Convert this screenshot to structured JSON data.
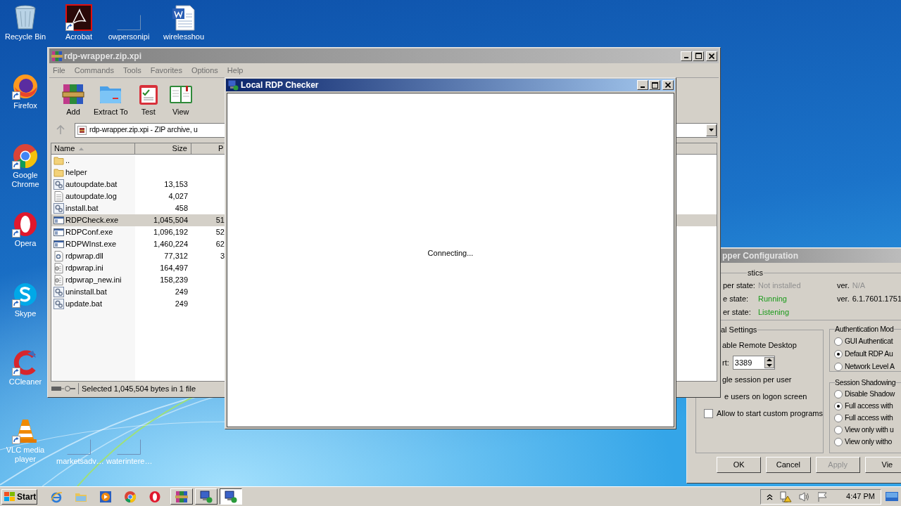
{
  "desktop_icons": [
    {
      "kind": "recycle-bin",
      "label": "Recycle Bin",
      "shortcut": false
    },
    {
      "kind": "acrobat",
      "label": "Acrobat",
      "shortcut": true
    },
    {
      "kind": "blank",
      "label": "owpersonipi",
      "shortcut": false
    },
    {
      "kind": "word",
      "label": "wirelesshou",
      "shortcut": false
    },
    {
      "kind": "firefox",
      "label": "Firefox",
      "shortcut": true
    },
    {
      "kind": "chrome",
      "label": "Google Chrome",
      "shortcut": true
    },
    {
      "kind": "opera",
      "label": "Opera",
      "shortcut": true
    },
    {
      "kind": "skype",
      "label": "Skype",
      "shortcut": true
    },
    {
      "kind": "ccleaner",
      "label": "CCleaner",
      "shortcut": true
    },
    {
      "kind": "vlc",
      "label": "VLC media player",
      "shortcut": true
    },
    {
      "kind": "blank",
      "label": "marketsadv…",
      "shortcut": false
    },
    {
      "kind": "blank",
      "label": "waterintere…",
      "shortcut": false
    }
  ],
  "config_window": {
    "title": "pper Configuration",
    "diagnostics": {
      "legend": "stics",
      "rows": [
        {
          "label": "per state:",
          "value": "Not installed",
          "kind": "na",
          "version_label": "ver.",
          "version": "N/A"
        },
        {
          "label": "e state:",
          "value": "Running",
          "kind": "ok",
          "version_label": "ver.",
          "version": "6.1.7601.1751"
        },
        {
          "label": "er state:",
          "value": "Listening",
          "kind": "ok"
        }
      ]
    },
    "general": {
      "legend": "al Settings",
      "items": [
        {
          "kind": "text",
          "label": "able Remote Desktop"
        },
        {
          "kind": "port",
          "label": "rt:",
          "value": "3389"
        },
        {
          "kind": "text",
          "label": "gle session per user"
        },
        {
          "kind": "text",
          "label": "e users on logon screen"
        },
        {
          "kind": "checkbox",
          "label": "Allow to start custom programs",
          "checked": false
        }
      ]
    },
    "authentication": {
      "legend": "Authentication Mod",
      "options": [
        {
          "label": "GUI Authenticat",
          "selected": false
        },
        {
          "label": "Default RDP Au",
          "selected": true
        },
        {
          "label": "Network Level A",
          "selected": false
        }
      ]
    },
    "shadowing": {
      "legend": "Session Shadowing",
      "options": [
        {
          "label": "Disable Shadow",
          "selected": false
        },
        {
          "label": "Full access with",
          "selected": true
        },
        {
          "label": "Full access with",
          "selected": false
        },
        {
          "label": "View only with u",
          "selected": false
        },
        {
          "label": "View only witho",
          "selected": false
        }
      ]
    },
    "buttons": [
      {
        "label": "OK",
        "disabled": false
      },
      {
        "label": "Cancel",
        "disabled": false
      },
      {
        "label": "Apply",
        "disabled": true
      },
      {
        "label": "Vie",
        "disabled": false
      }
    ]
  },
  "archive_window": {
    "title": "rdp-wrapper.zip.xpi",
    "menu": [
      "File",
      "Commands",
      "Tools",
      "Favorites",
      "Options",
      "Help"
    ],
    "toolbar": [
      {
        "kind": "add",
        "label": "Add"
      },
      {
        "kind": "extract",
        "label": "Extract To"
      },
      {
        "kind": "test",
        "label": "Test"
      },
      {
        "kind": "view",
        "label": "View"
      }
    ],
    "path": "rdp-wrapper.zip.xpi - ZIP archive, u",
    "columns": [
      "Name",
      "Size",
      "P"
    ],
    "rows": [
      {
        "kind": "folder",
        "name": "..",
        "selected": false
      },
      {
        "kind": "folder",
        "name": "helper",
        "selected": false
      },
      {
        "kind": "script",
        "name": "autoupdate.bat",
        "size": "13,153",
        "selected": false
      },
      {
        "kind": "text",
        "name": "autoupdate.log",
        "size": "4,027",
        "selected": false
      },
      {
        "kind": "script",
        "name": "install.bat",
        "size": "458",
        "selected": false
      },
      {
        "kind": "exe",
        "name": "RDPCheck.exe",
        "size": "1,045,504",
        "packed": "51",
        "selected": true
      },
      {
        "kind": "exe",
        "name": "RDPConf.exe",
        "size": "1,096,192",
        "packed": "52",
        "selected": false
      },
      {
        "kind": "exe",
        "name": "RDPWInst.exe",
        "size": "1,460,224",
        "packed": "62",
        "selected": false
      },
      {
        "kind": "dll",
        "name": "rdpwrap.dll",
        "size": "77,312",
        "packed": "3",
        "selected": false
      },
      {
        "kind": "ini",
        "name": "rdpwrap.ini",
        "size": "164,497",
        "selected": false
      },
      {
        "kind": "ini",
        "name": "rdpwrap_new.ini",
        "size": "158,239",
        "selected": false
      },
      {
        "kind": "script",
        "name": "uninstall.bat",
        "size": "249",
        "selected": false
      },
      {
        "kind": "script",
        "name": "update.bat",
        "size": "249",
        "selected": false
      }
    ],
    "status": "Selected 1,045,504 bytes in 1 file"
  },
  "checker_window": {
    "title": "Local RDP Checker",
    "message": "Connecting..."
  },
  "taskbar": {
    "start": "Start",
    "quick_launch": [
      {
        "kind": "ie"
      },
      {
        "kind": "explorer"
      },
      {
        "kind": "media"
      },
      {
        "kind": "chrome"
      },
      {
        "kind": "opera"
      }
    ],
    "windows": [
      {
        "kind": "archiver",
        "selected": false
      },
      {
        "kind": "rdp",
        "selected": false
      },
      {
        "kind": "rdp",
        "selected": true
      }
    ],
    "tray": [
      {
        "kind": "expand"
      },
      {
        "kind": "network"
      },
      {
        "kind": "speaker"
      },
      {
        "kind": "flag"
      }
    ],
    "clock": "4:47 PM"
  }
}
